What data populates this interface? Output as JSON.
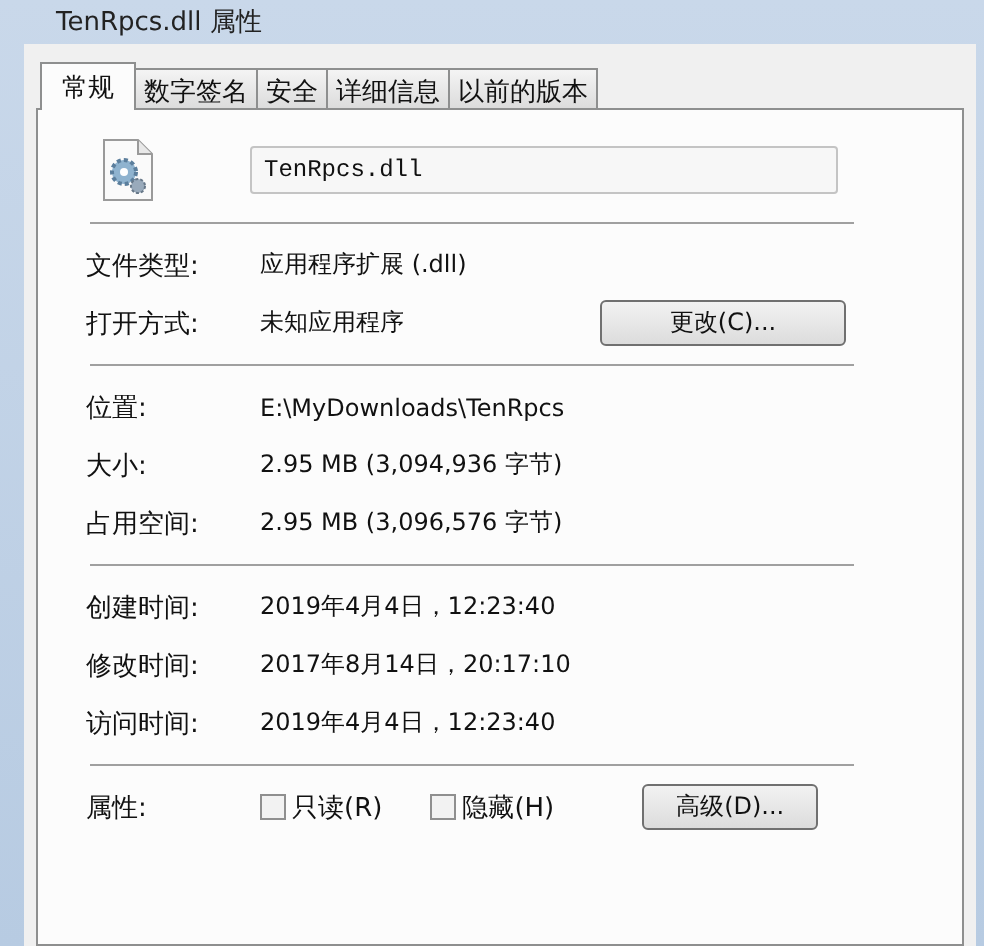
{
  "window": {
    "title": "TenRpcs.dll 属性"
  },
  "tabs": [
    {
      "label": "常规",
      "selected": true
    },
    {
      "label": "数字签名",
      "selected": false
    },
    {
      "label": "安全",
      "selected": false
    },
    {
      "label": "详细信息",
      "selected": false
    },
    {
      "label": "以前的版本",
      "selected": false
    }
  ],
  "file_name": "TenRpcs.dll",
  "sections": [
    [
      {
        "label": "文件类型:",
        "value": "应用程序扩展 (.dll)"
      },
      {
        "label": "打开方式:",
        "value": "未知应用程序",
        "button": "更改(C)..."
      }
    ],
    [
      {
        "label": "位置:",
        "value": "E:\\MyDownloads\\TenRpcs"
      },
      {
        "label": "大小:",
        "value": "2.95 MB (3,094,936 字节)"
      },
      {
        "label": "占用空间:",
        "value": "2.95 MB (3,096,576 字节)"
      }
    ],
    [
      {
        "label": "创建时间:",
        "value": "2019年4月4日，12:23:40"
      },
      {
        "label": "修改时间:",
        "value": "2017年8月14日，20:17:10"
      },
      {
        "label": "访问时间:",
        "value": "2019年4月4日，12:23:40"
      }
    ]
  ],
  "attributes": {
    "label": "属性:",
    "checkboxes": [
      {
        "label": "只读(R)",
        "checked": false
      },
      {
        "label": "隐藏(H)",
        "checked": false
      }
    ],
    "button": "高级(D)..."
  }
}
